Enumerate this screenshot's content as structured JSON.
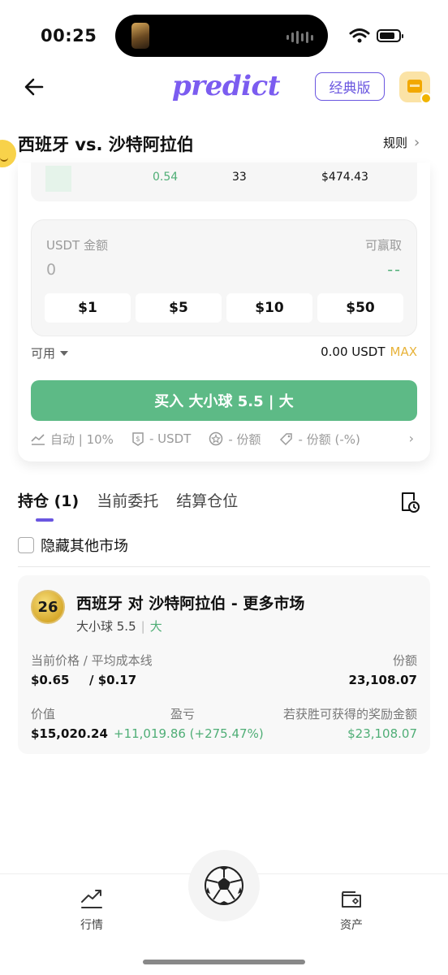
{
  "status_bar": {
    "time": "00:25"
  },
  "header": {
    "logo": "predict",
    "classic_label": "经典版"
  },
  "match": {
    "title": "西班牙 vs. 沙特阿拉伯",
    "rules_label": "规则"
  },
  "orderbook": {
    "price": "0.54",
    "shares": "33",
    "total": "$474.43"
  },
  "trade": {
    "amount_label": "USDT 金额",
    "amount_value": "0",
    "win_label": "可赢取",
    "win_value": "--",
    "quick_amounts": [
      "$1",
      "$5",
      "$10",
      "$50"
    ],
    "available_label": "可用",
    "balance": "0.00 USDT",
    "max_label": "MAX",
    "buy_label": "买入 大小球 5.5 | 大",
    "settings": {
      "auto": "自动 | 10%",
      "usdt": "- USDT",
      "shares": "- 份额",
      "shares_pct": "- 份额 (-%)"
    }
  },
  "tabs": {
    "positions": "持仓 (1)",
    "orders": "当前委托",
    "settled": "结算仓位",
    "hide_other": "隐藏其他市场"
  },
  "position": {
    "badge": "26",
    "title": "西班牙 对 沙特阿拉伯 - 更多市场",
    "market": "大小球 5.5",
    "side": "大",
    "price_label": "当前价格 / 平均成本线",
    "price_current": "$0.65",
    "price_avg": "/ $0.17",
    "shares_label": "份额",
    "shares_value": "23,108.07",
    "value_label": "价值",
    "value_value": "$15,020.24",
    "pnl_label": "盈亏",
    "pnl_value": "+11,019.86 (+275.47%)",
    "reward_label": "若获胜可获得的奖励金额",
    "reward_value": "$23,108.07"
  },
  "bottom_nav": {
    "market": "行情",
    "assets": "资产"
  },
  "colors": {
    "brand": "#7b5cf0",
    "buy_green": "#5dba86",
    "gain_green": "#4fae76",
    "max_gold": "#e8b33a"
  }
}
